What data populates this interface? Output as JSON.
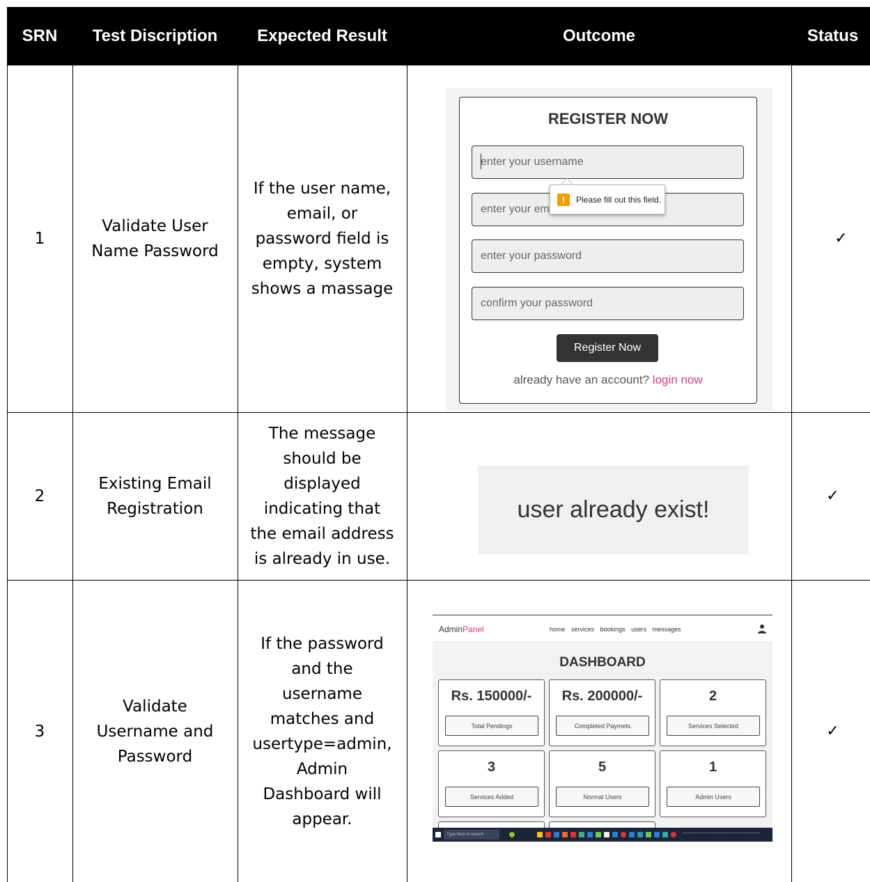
{
  "header": {
    "srn": "SRN",
    "test": "Test Discription",
    "expected": "Expected Result",
    "outcome": "Outcome",
    "status": "Status"
  },
  "rows": [
    {
      "srn": "1",
      "test": [
        "Validate User",
        "Name Password"
      ],
      "expected": [
        "If the user name,",
        "email, or",
        "password field is",
        "empty, system",
        "shows a massage"
      ],
      "status": "✓"
    },
    {
      "srn": "2",
      "test": [
        "Existing Email",
        "Registration"
      ],
      "expected": [
        "The message",
        "should be",
        "displayed",
        "indicating that",
        "the email address",
        "is already in use."
      ],
      "status": "✓"
    },
    {
      "srn": "3",
      "test": [
        "Validate",
        "Username and",
        "Password"
      ],
      "expected": [
        "If the password",
        "and the",
        "username",
        "matches and",
        "usertype=admin,",
        "Admin",
        "Dashboard will",
        "appear."
      ],
      "status": "✓"
    }
  ],
  "register": {
    "title": "REGISTER NOW",
    "username_placeholder": "enter your username",
    "email_placeholder": "enter your em",
    "password_placeholder": "enter your password",
    "confirm_placeholder": "confirm your password",
    "tooltip_text": "Please fill out this field.",
    "tooltip_icon": "!",
    "button": "Register Now",
    "account_text": "already have an account?",
    "login_link": "login now",
    "link_color": "#e0338e"
  },
  "exist": {
    "message": "user already exist!"
  },
  "dashboard": {
    "logo_a": "Admin",
    "logo_b": "Panel",
    "nav": [
      "home",
      "services",
      "bookings",
      "users",
      "messages"
    ],
    "title": "DASHBOARD",
    "cards": [
      {
        "value": "Rs. 150000/-",
        "label": "Total Pendings"
      },
      {
        "value": "Rs. 200000/-",
        "label": "Completed Paymets"
      },
      {
        "value": "2",
        "label": "Services Selected"
      },
      {
        "value": "3",
        "label": "Services Added"
      },
      {
        "value": "5",
        "label": "Normal Users"
      },
      {
        "value": "1",
        "label": "Admin Users"
      }
    ],
    "taskbar_search": "Type here to search"
  }
}
